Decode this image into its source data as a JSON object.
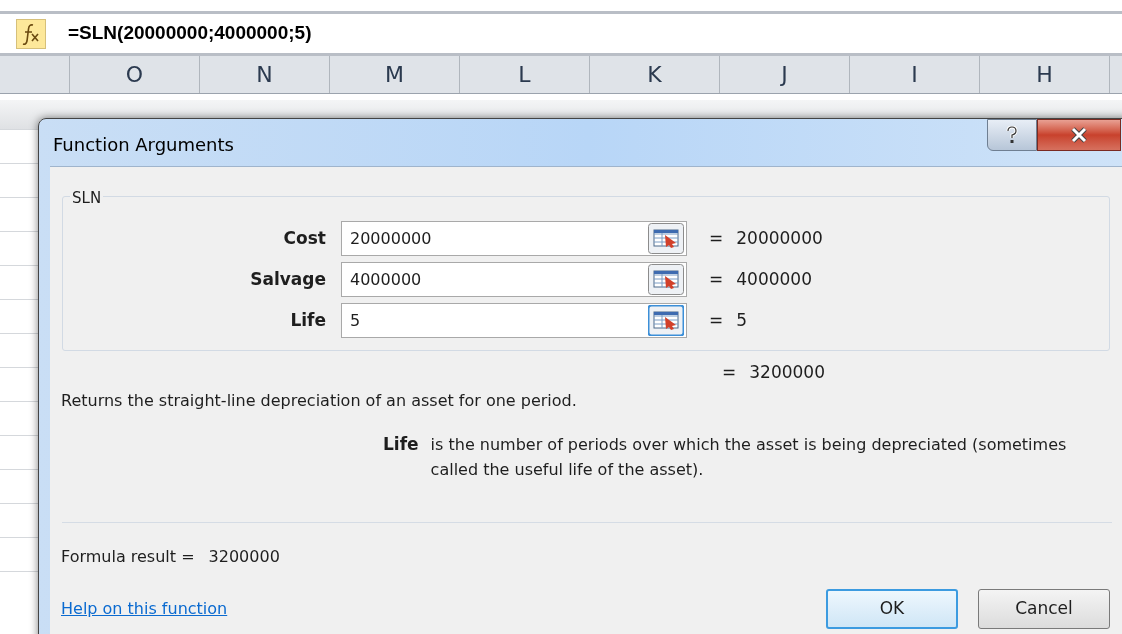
{
  "formula_bar": {
    "text": "=SLN(20000000;4000000;5)"
  },
  "columns": [
    "O",
    "N",
    "M",
    "L",
    "K",
    "J",
    "I",
    "H"
  ],
  "dialog": {
    "title": "Function Arguments",
    "function_name": "SLN",
    "arguments": [
      {
        "label": "Cost",
        "value": "20000000",
        "equals": "=",
        "result": "20000000",
        "focused": false
      },
      {
        "label": "Salvage",
        "value": "4000000",
        "equals": "=",
        "result": "4000000",
        "focused": false
      },
      {
        "label": "Life",
        "value": "5",
        "equals": "=",
        "result": "5",
        "focused": true
      }
    ],
    "result_equals": "=",
    "result": "3200000",
    "description": "Returns the straight-line depreciation of an asset for one period.",
    "argument_help": {
      "name": "Life",
      "text": "is the number of periods over which the asset is being depreciated (sometimes called the useful life of the asset)."
    },
    "formula_result": {
      "label": "Formula result =",
      "value": "3200000"
    },
    "help_link": "Help on this function",
    "buttons": [
      {
        "label": "OK",
        "default": true
      },
      {
        "label": "Cancel",
        "default": false
      }
    ]
  }
}
